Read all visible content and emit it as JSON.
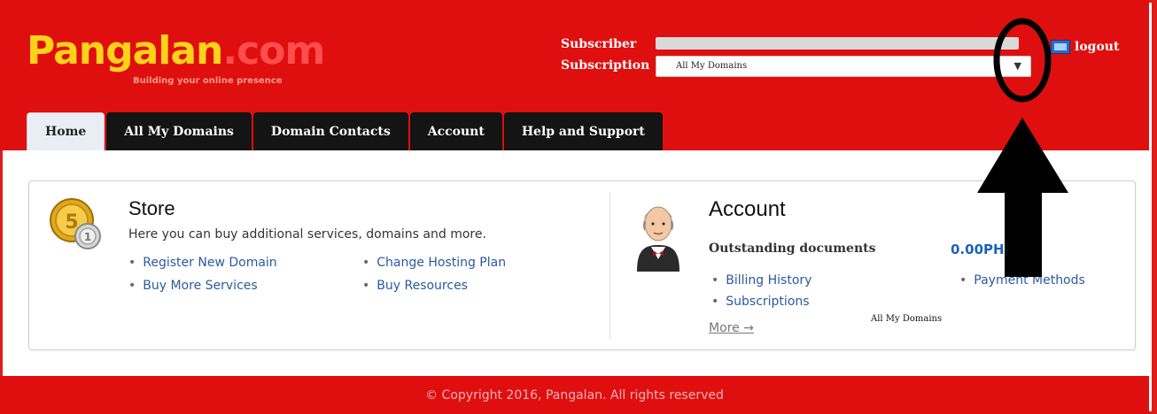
{
  "brand": {
    "logo_main": "Pangalan",
    "logo_suffix": ".com",
    "tagline": "Building your online presence",
    "primary_color": "#e00f0f",
    "logo_color": "#ffd21a"
  },
  "header": {
    "subscriber_label": "Subscriber",
    "subscription_label": "Subscription",
    "subscription_selected": "All My Domains",
    "logout_label": "logout"
  },
  "tabs": [
    {
      "label": "Home",
      "active": true
    },
    {
      "label": "All My Domains",
      "active": false
    },
    {
      "label": "Domain Contacts",
      "active": false
    },
    {
      "label": "Account",
      "active": false
    },
    {
      "label": "Help and Support",
      "active": false
    }
  ],
  "store": {
    "title": "Store",
    "description": "Here you can buy additional services, domains and more.",
    "links": [
      "Register New Domain",
      "Change Hosting Plan",
      "Buy More Services",
      "Buy Resources"
    ]
  },
  "account": {
    "title": "Account",
    "outstanding_label": "Outstanding documents",
    "outstanding_amount": "0.00PH",
    "links": [
      "Billing History",
      "Payment Methods",
      "Subscriptions"
    ],
    "more_label": "More →",
    "tooltip": "All My Domains"
  },
  "footer": {
    "copyright": "© Copyright 2016, Pangalan. All rights reserved"
  },
  "icons": {
    "coin": "coin-icon",
    "butler": "butler-avatar-icon",
    "logout": "logout-icon",
    "dropdown": "chevron-down-icon"
  }
}
